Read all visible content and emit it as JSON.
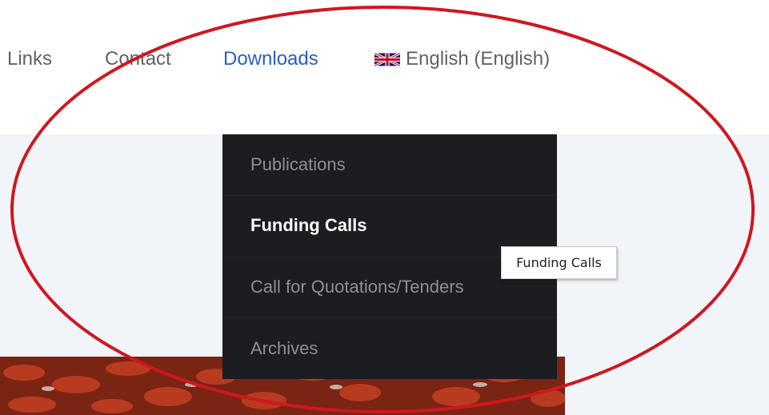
{
  "nav": {
    "items": [
      {
        "label": "Links"
      },
      {
        "label": "Contact"
      },
      {
        "label": "Downloads",
        "active": true
      }
    ],
    "language": {
      "label": "English (English)",
      "flag_icon": "uk-flag-icon"
    },
    "active_color": "#2c5cc5"
  },
  "downloads_menu": {
    "items": [
      {
        "label": "Publications"
      },
      {
        "label": "Funding Calls",
        "hovered": true
      },
      {
        "label": "Call for Quotations/Tenders"
      },
      {
        "label": "Archives"
      }
    ],
    "background": "#1b1d20"
  },
  "tooltip": {
    "text": "Funding Calls"
  },
  "annotation": {
    "shape": "ellipse",
    "color": "#d0161f"
  }
}
